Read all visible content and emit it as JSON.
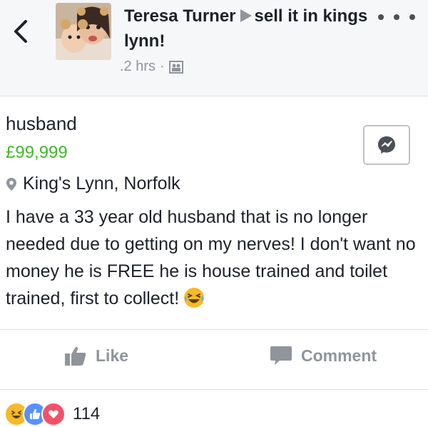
{
  "header": {
    "author": "Teresa Turner",
    "group": "sell it in kings lynn!",
    "time": ".2 hrs",
    "separator": "·"
  },
  "listing": {
    "title": "husband",
    "price": "£99,999",
    "location": "King's Lynn, Norfolk",
    "description": "I have a 33 year old husband that is no longer needed due to getting on my nerves! I don't want no money he is FREE he is house trained and toilet trained, first to collect!"
  },
  "actions": {
    "like_label": "Like",
    "comment_label": "Comment"
  },
  "reactions": {
    "count": "114"
  },
  "colors": {
    "price": "#42b72a",
    "like_blue": "#5890ff",
    "love_red": "#f25268",
    "haha_yellow": "#f7b928",
    "muted": "#90949c"
  }
}
